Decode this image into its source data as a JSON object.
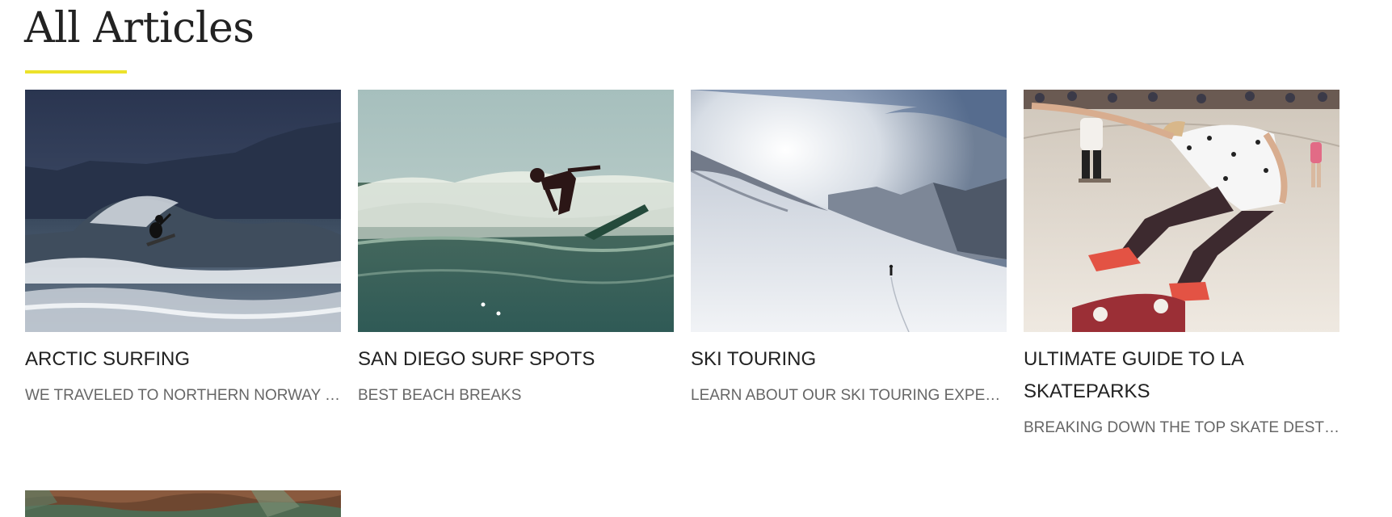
{
  "page": {
    "title": "All Articles",
    "accent_color": "#ece22b"
  },
  "articles": [
    {
      "title": "ARCTIC SURFING",
      "description": "WE TRAVELED TO NORTHERN NORWAY TO…",
      "image": "arctic-surfer-photo"
    },
    {
      "title": "SAN DIEGO SURF SPOTS",
      "description": "BEST BEACH BREAKS",
      "image": "san-diego-surfer-photo"
    },
    {
      "title": "SKI TOURING",
      "description": "LEARN ABOUT OUR SKI TOURING EXPERIE…",
      "image": "ski-touring-mountain-photo"
    },
    {
      "title": "ULTIMATE GUIDE TO LA SKATEPARKS",
      "description": "BREAKING DOWN THE TOP SKATE DESTIN…",
      "image": "skateboarder-photo"
    },
    {
      "title": "",
      "description": "",
      "image": "canyon-photo"
    }
  ]
}
